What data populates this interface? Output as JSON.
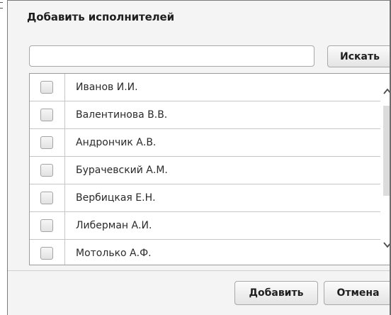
{
  "dialog": {
    "title": "Добавить исполнителей"
  },
  "search": {
    "value": "",
    "placeholder": "",
    "button_label": "Искать"
  },
  "list": {
    "items": [
      {
        "name": "Иванов И.И.",
        "checked": false
      },
      {
        "name": "Валентинова В.В.",
        "checked": false
      },
      {
        "name": "Андрончик А.В.",
        "checked": false
      },
      {
        "name": "Бурачевский А.М.",
        "checked": false
      },
      {
        "name": "Вербицкая Е.Н.",
        "checked": false
      },
      {
        "name": "Либерман А.И.",
        "checked": false
      },
      {
        "name": "Мотолько А.Ф.",
        "checked": false
      }
    ],
    "scrollbar": {
      "up_icon": "chevron-up-icon",
      "down_icon": "chevron-down-icon"
    }
  },
  "footer": {
    "add_label": "Добавить",
    "cancel_label": "Отмена"
  },
  "colors": {
    "background": "#f4f4f4",
    "list_background": "#ffffff",
    "row_border": "#c6c6c6",
    "scroll_thumb": "#dcdcdc"
  }
}
